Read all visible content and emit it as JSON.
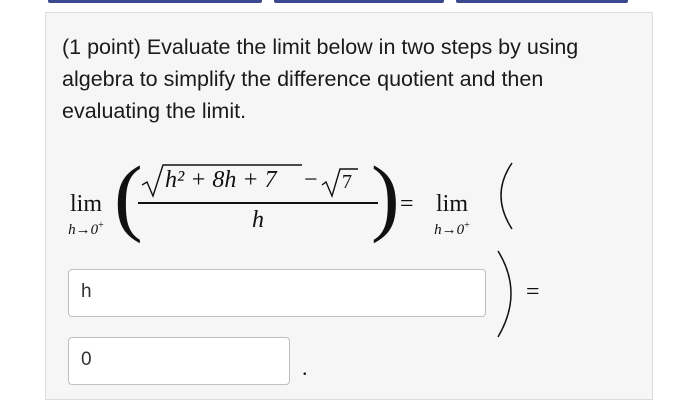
{
  "problem": {
    "prompt": "(1 point) Evaluate the limit below in two steps by using algebra to simplify the difference quotient and then evaluating the limit."
  },
  "expression": {
    "lim_word": "lim",
    "lim_sub_var": "h→0",
    "lim_sub_sup": "+",
    "numerator_radicand": "h² + 8h + 7",
    "minus": "−",
    "seven": "7",
    "denominator": "h",
    "equals": "=",
    "left_paren": "(",
    "right_paren": ")"
  },
  "inputs": {
    "numerator_value": "h",
    "limit_value": "0"
  },
  "punctuation": {
    "period": "."
  },
  "colors": {
    "tab_accent": "#3b4a8f",
    "card_bg": "#f6f6f6",
    "card_border": "#dcdcdc"
  }
}
